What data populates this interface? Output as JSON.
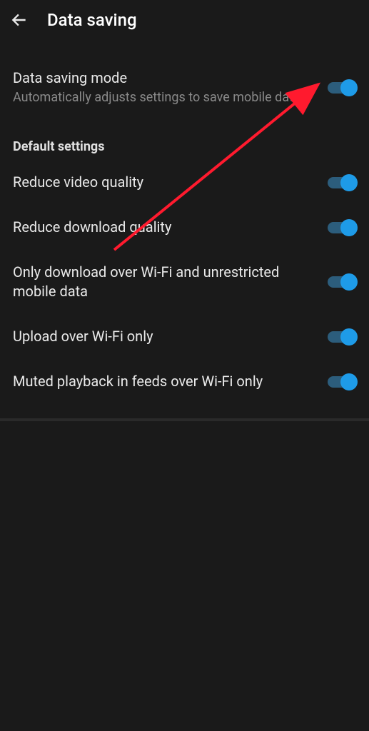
{
  "header": {
    "title": "Data saving"
  },
  "main_toggle": {
    "title": "Data saving mode",
    "subtitle": "Automatically adjusts settings to save mobile data"
  },
  "section_header": "Default settings",
  "settings": [
    {
      "label": "Reduce video quality"
    },
    {
      "label": "Reduce download quality"
    },
    {
      "label": "Only download over Wi-Fi and unrestricted mobile data"
    },
    {
      "label": "Upload over Wi-Fi only"
    },
    {
      "label": "Muted playback in feeds over Wi-Fi only"
    }
  ]
}
